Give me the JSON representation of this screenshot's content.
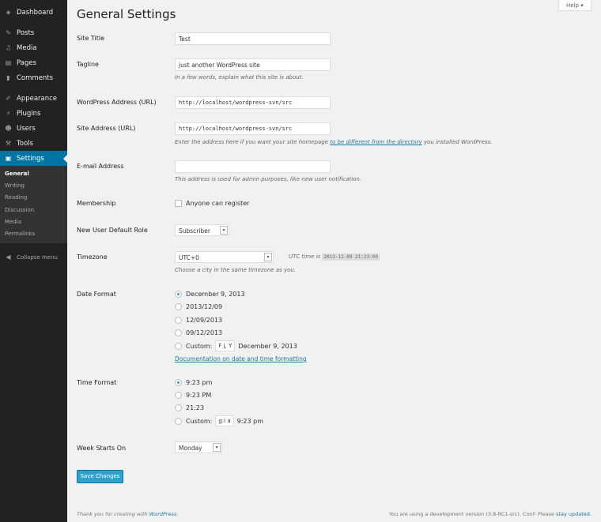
{
  "sidebar": {
    "items": [
      {
        "label": "Dashboard",
        "icon": "dashboard-icon",
        "g": "◈"
      },
      {
        "label": "Posts",
        "icon": "pin-icon",
        "g": "✎"
      },
      {
        "label": "Media",
        "icon": "media-icon",
        "g": "♫"
      },
      {
        "label": "Pages",
        "icon": "pages-icon",
        "g": "▤"
      },
      {
        "label": "Comments",
        "icon": "comments-icon",
        "g": "▮"
      },
      {
        "label": "Appearance",
        "icon": "appearance-icon",
        "g": "✐"
      },
      {
        "label": "Plugins",
        "icon": "plugins-icon",
        "g": "⚡"
      },
      {
        "label": "Users",
        "icon": "users-icon",
        "g": "☻"
      },
      {
        "label": "Tools",
        "icon": "tools-icon",
        "g": "⚒"
      },
      {
        "label": "Settings",
        "icon": "settings-icon",
        "g": "▣"
      }
    ],
    "submenu": [
      "General",
      "Writing",
      "Reading",
      "Discussion",
      "Media",
      "Permalinks"
    ],
    "collapse": "Collapse menu"
  },
  "help": "Help",
  "title": "General Settings",
  "fields": {
    "site_title": {
      "label": "Site Title",
      "value": "Test"
    },
    "tagline": {
      "label": "Tagline",
      "value": "just another WordPress site",
      "desc": "In a few words, explain what this site is about."
    },
    "wp_url": {
      "label": "WordPress Address (URL)",
      "value": "http://localhost/wordpress-svn/src"
    },
    "site_url": {
      "label": "Site Address (URL)",
      "value": "http://localhost/wordpress-svn/src",
      "desc_pre": "Enter the address here if you want your site homepage ",
      "desc_link": "to be different from the directory",
      "desc_post": " you installed WordPress."
    },
    "email": {
      "label": "E-mail Address",
      "value": "",
      "desc": "This address is used for admin purposes, like new user notification."
    },
    "membership": {
      "label": "Membership",
      "checkbox": "Anyone can register",
      "checked": false
    },
    "role": {
      "label": "New User Default Role",
      "value": "Subscriber"
    },
    "timezone": {
      "label": "Timezone",
      "value": "UTC+0",
      "utc_label": "UTC time is",
      "utc_time": "2013-12-09 21:23:00",
      "desc": "Choose a city in the same timezone as you."
    },
    "date_format": {
      "label": "Date Format",
      "options": [
        "December 9, 2013",
        "2013/12/09",
        "12/09/2013",
        "09/12/2013"
      ],
      "selected": 0,
      "custom_label": "Custom:",
      "custom_value": "F j, Y",
      "custom_preview": "December 9, 2013",
      "doc_link": "Documentation on date and time formatting"
    },
    "time_format": {
      "label": "Time Format",
      "options": [
        "9:23 pm",
        "9:23 PM",
        "21:23"
      ],
      "selected": 0,
      "custom_label": "Custom:",
      "custom_value": "g:i a",
      "custom_preview": "9:23 pm"
    },
    "week": {
      "label": "Week Starts On",
      "value": "Monday"
    }
  },
  "save": "Save Changes",
  "footer": {
    "left_pre": "Thank you for creating with ",
    "left_link": "WordPress",
    "right_pre": "You are using a development version (3.8-RC1-src). Cool! Please ",
    "right_link": "stay updated"
  },
  "colors": {
    "accent": "#0074a2",
    "button": "#2ea2cc",
    "link": "#21759b"
  }
}
